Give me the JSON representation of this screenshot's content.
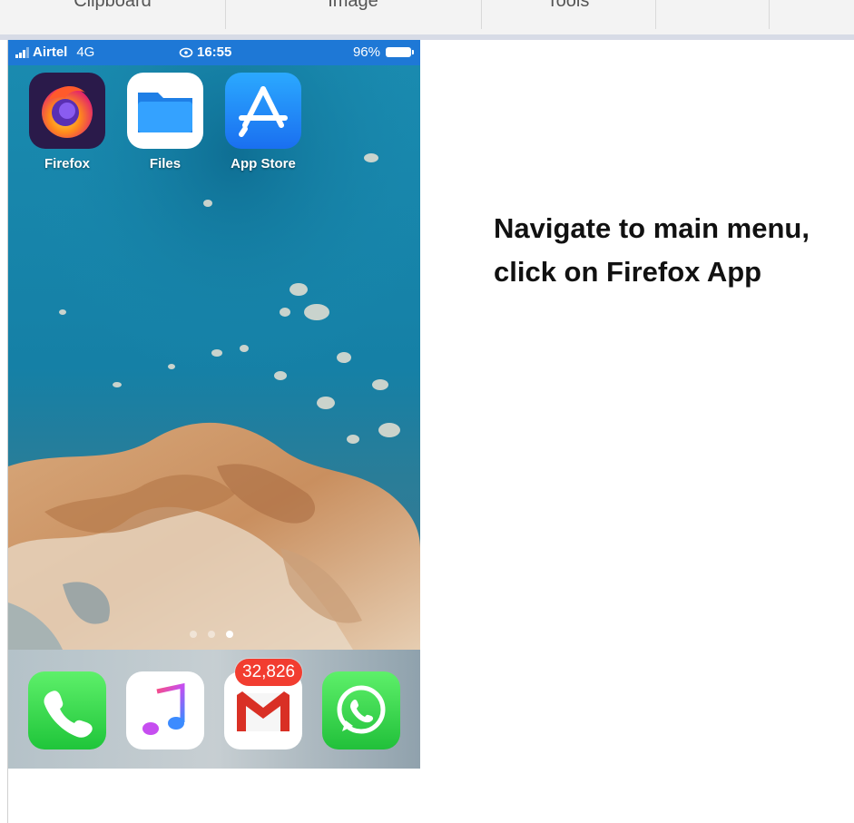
{
  "ribbon": {
    "groups": [
      "Clipboard",
      "Image",
      "Tools",
      "",
      ""
    ]
  },
  "phone": {
    "status_bar": {
      "carrier": "Airtel",
      "network": "4G",
      "time": "16:55",
      "battery": "96%",
      "battery_level": 0.96
    },
    "home_apps": [
      {
        "label": "Firefox",
        "icon": "firefox-icon"
      },
      {
        "label": "Files",
        "icon": "files-folder-icon"
      },
      {
        "label": "App Store",
        "icon": "app-store-icon"
      }
    ],
    "page_indicator": {
      "count": 3,
      "active": 3
    },
    "dock": {
      "apps": [
        {
          "name": "Phone",
          "icon": "phone-icon"
        },
        {
          "name": "Music",
          "icon": "music-note-icon"
        },
        {
          "name": "Gmail",
          "icon": "gmail-icon"
        },
        {
          "name": "WhatsApp",
          "icon": "whatsapp-icon"
        }
      ],
      "gmail_badge": "32,826"
    }
  },
  "instruction": {
    "text": "Navigate to main menu, click on Firefox App"
  },
  "colors": {
    "status_bar": "#1e78d6",
    "badge": "#f23d30",
    "ribbon_bg": "#f3f3f3"
  }
}
